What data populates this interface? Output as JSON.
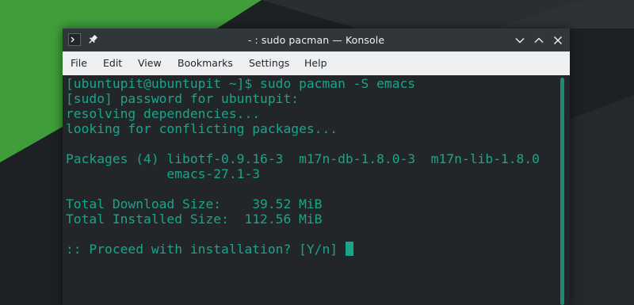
{
  "window": {
    "title": "- : sudo pacman — Konsole",
    "app_icon": "terminal-icon",
    "pin_icon": "pin-icon",
    "controls": [
      "chevron-down-icon",
      "chevron-up-icon",
      "close-icon"
    ]
  },
  "menubar": {
    "items": [
      "File",
      "Edit",
      "View",
      "Bookmarks",
      "Settings",
      "Help"
    ]
  },
  "terminal": {
    "lines": [
      "[ubuntupit@ubuntupit ~]$ sudo pacman -S emacs",
      "[sudo] password for ubuntupit:",
      "resolving dependencies...",
      "looking for conflicting packages...",
      "",
      "Packages (4) libotf-0.9.16-3  m17n-db-1.8.0-3  m17n-lib-1.8.0",
      "             emacs-27.1-3",
      "",
      "Total Download Size:    39.52 MiB",
      "Total Installed Size:  112.56 MiB",
      "",
      ":: Proceed with installation? [Y/n] "
    ],
    "text_color": "#1aa58a",
    "background": "#232629"
  },
  "desktop": {
    "accent_green": "#3f9e3a",
    "background": "#1e2124"
  }
}
